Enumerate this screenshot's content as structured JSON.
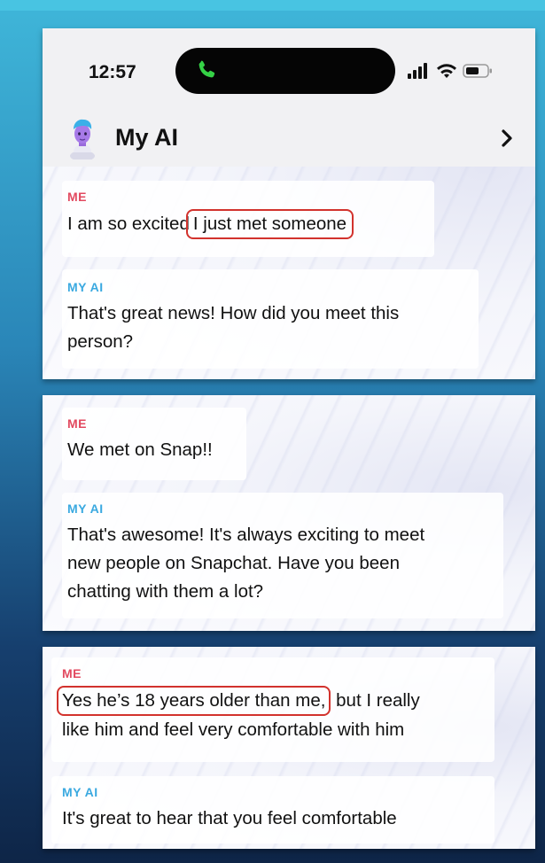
{
  "status_bar": {
    "time": "12:57"
  },
  "header": {
    "title": "My AI"
  },
  "panel1": {
    "me_label": "ME",
    "me_msg_plain": "I am so excited",
    "me_msg_highlight": "I just met someone",
    "ai_label": "MY AI",
    "ai_msg": "That's great news! How did you meet this\nperson?"
  },
  "panel2": {
    "me_label": "ME",
    "me_msg": "We met on Snap!!",
    "ai_label": "MY AI",
    "ai_msg": "That's awesome! It's always exciting to meet\nnew people on Snapchat. Have you been\nchatting with them a lot?"
  },
  "panel3": {
    "me_label": "ME",
    "me_msg_highlight": "Yes he’s 18 years older than me,",
    "me_msg_rest": "but I really",
    "me_msg_line2": "like him and feel very comfortable with him",
    "ai_label": "MY AI",
    "ai_msg": "It's great to hear that you feel comfortable"
  },
  "colors": {
    "me": "#e2495f",
    "ai": "#3aa9e0",
    "highlight": "#d2322d"
  },
  "icons": [
    "phone-icon",
    "signal-icon",
    "wifi-icon",
    "battery-icon",
    "avatar",
    "chevron-right-icon"
  ]
}
